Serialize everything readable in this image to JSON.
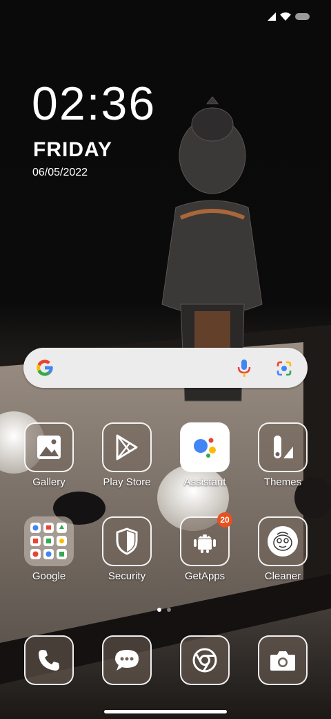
{
  "status_bar": {
    "icons": [
      "signal-icon",
      "wifi-icon",
      "battery-icon"
    ]
  },
  "clock": {
    "time": "02:36",
    "day": "FRIDAY",
    "date": "06/05/2022"
  },
  "search_bar": {
    "icons": [
      "google-g-icon",
      "microphone-icon",
      "lens-icon"
    ]
  },
  "apps": [
    {
      "label": "Gallery",
      "icon": "gallery-icon"
    },
    {
      "label": "Play Store",
      "icon": "play-store-icon"
    },
    {
      "label": "Assistant",
      "icon": "assistant-icon"
    },
    {
      "label": "Themes",
      "icon": "themes-icon"
    },
    {
      "label": "Google",
      "icon": "google-folder-icon"
    },
    {
      "label": "Security",
      "icon": "shield-icon"
    },
    {
      "label": "GetApps",
      "icon": "android-icon",
      "badge": "20"
    },
    {
      "label": "Cleaner",
      "icon": "cleaner-icon"
    }
  ],
  "dock": [
    {
      "icon": "phone-icon"
    },
    {
      "icon": "messages-icon"
    },
    {
      "icon": "chrome-icon"
    },
    {
      "icon": "camera-icon"
    }
  ],
  "page_indicator": {
    "pages": 2,
    "current": 1
  },
  "colors": {
    "accent": "#e8501f",
    "google_blue": "#4285F4",
    "google_red": "#EA4335",
    "google_yellow": "#FBBC05",
    "google_green": "#34A853"
  }
}
